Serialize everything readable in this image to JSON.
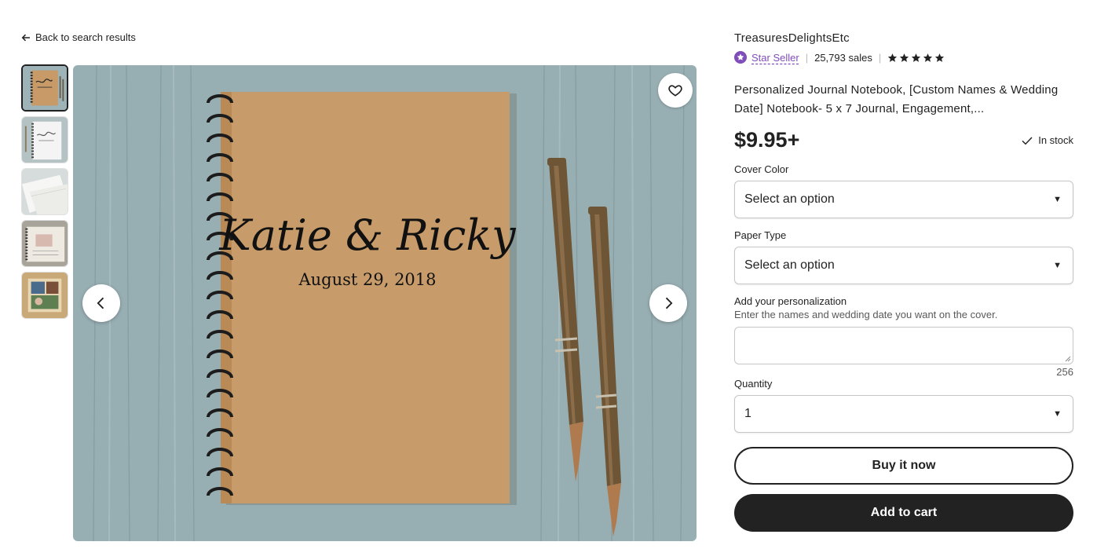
{
  "nav": {
    "back_label": "Back to search results"
  },
  "gallery": {
    "thumbnail_count": 5,
    "hero_cover_text": {
      "names": "Katie & Ricky",
      "date": "August 29, 2018"
    }
  },
  "shop": {
    "name": "TreasuresDelightsEtc",
    "badge_label": "Star Seller",
    "sales": "25,793 sales",
    "rating_stars": 5
  },
  "listing": {
    "title": "Personalized Journal Notebook, [Custom Names & Wedding Date] Notebook- 5 x 7 Journal, Engagement,...",
    "price": "$9.95+",
    "stock": "In stock"
  },
  "options": {
    "cover_color": {
      "label": "Cover Color",
      "value": "Select an option"
    },
    "paper_type": {
      "label": "Paper Type",
      "value": "Select an option"
    },
    "personalization": {
      "label": "Add your personalization",
      "hint": "Enter the names and wedding date you want on the cover.",
      "value": "",
      "char_limit": "256"
    },
    "quantity": {
      "label": "Quantity",
      "value": "1"
    }
  },
  "actions": {
    "buy_now": "Buy it now",
    "add_to_cart": "Add to cart"
  },
  "colors": {
    "accent_purple": "#7f4dba",
    "text": "#222222",
    "button_dark": "#222222",
    "background": "#ffffff"
  }
}
